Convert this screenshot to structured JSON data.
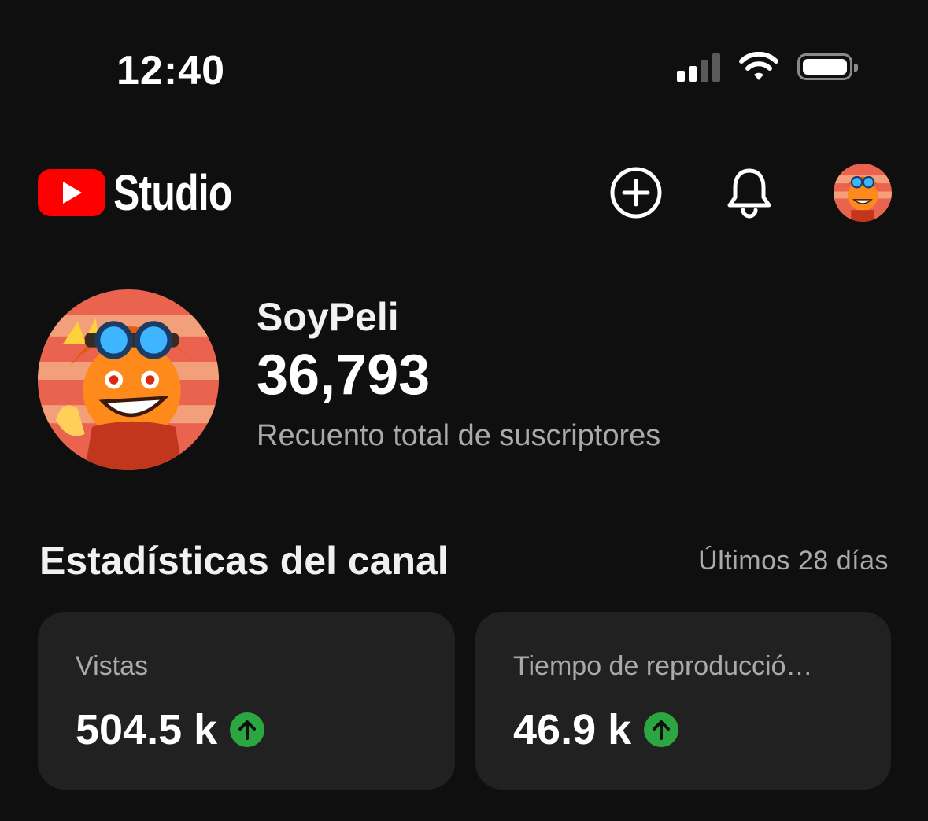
{
  "status_bar": {
    "time": "12:40",
    "icons": [
      "cellular-signal-icon",
      "wifi-icon",
      "battery-icon"
    ]
  },
  "header": {
    "logo_text": "Studio",
    "icons": [
      "youtube-play-icon",
      "create-plus-icon",
      "notifications-bell-icon",
      "account-avatar"
    ]
  },
  "channel": {
    "name": "SoyPeli",
    "subscriber_count": "36,793",
    "subscriber_label": "Recuento total de suscriptores"
  },
  "stats": {
    "title": "Estadísticas del canal",
    "range": "Últimos 28 días",
    "cards": [
      {
        "label": "Vistas",
        "value": "504.5 k",
        "trend": "up",
        "trend_icon": "arrow-up-icon"
      },
      {
        "label": "Tiempo de reproducció…",
        "value": "46.9 k",
        "trend": "up",
        "trend_icon": "arrow-up-icon"
      }
    ]
  },
  "colors": {
    "background": "#0f0f0f",
    "card": "#212121",
    "brand_red": "#ff0000",
    "trend_green": "#2ba640",
    "secondary_text": "#aaaaaa"
  }
}
